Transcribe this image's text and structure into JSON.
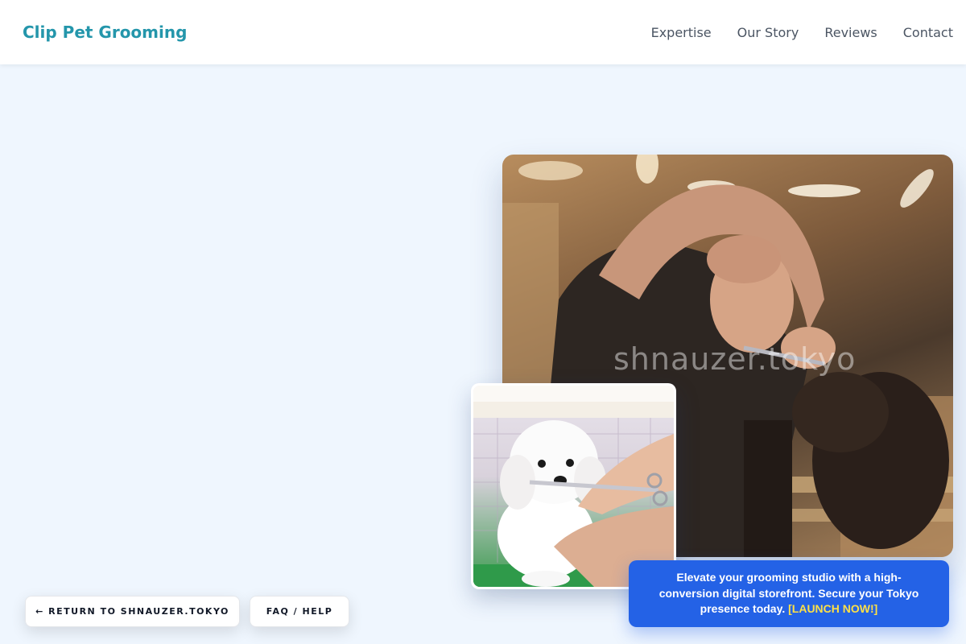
{
  "header": {
    "logo": "Clip Pet Grooming",
    "nav": [
      {
        "label": "Expertise"
      },
      {
        "label": "Our Story"
      },
      {
        "label": "Reviews"
      },
      {
        "label": "Contact"
      }
    ]
  },
  "hero": {
    "main_image": {
      "watermark": "shnauzer.tokyo",
      "icon": "groomer-trimming-dog-photo"
    },
    "inset_image": {
      "icon": "white-poodle-scissors-photo"
    }
  },
  "buttons": {
    "return_label": "← RETURN TO SHNAUZER.TOKYO",
    "faq_label": "FAQ / HELP"
  },
  "promo": {
    "text": "Elevate your grooming studio with a high-conversion digital storefront. Secure your Tokyo presence today.",
    "cta": "[LAUNCH NOW!]"
  },
  "colors": {
    "brand": "#2496ab",
    "background": "#eff6fe",
    "promo_bg": "#2462e6",
    "cta": "#fde047"
  }
}
